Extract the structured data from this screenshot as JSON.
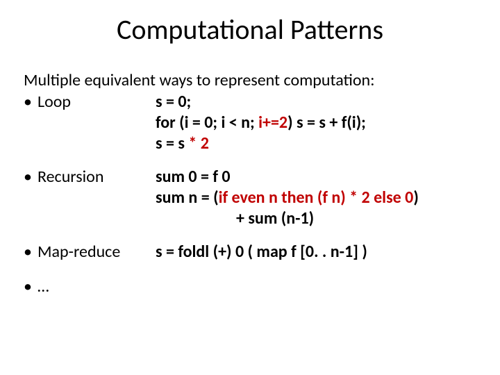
{
  "title": "Computational Patterns",
  "lead": "Multiple equivalent ways to represent computation:",
  "bullets": {
    "loop": "Loop",
    "recursion": "Recursion",
    "mapreduce": "Map-reduce",
    "ellipsis": "…"
  },
  "loop": {
    "l1": "s = 0;",
    "l2a": "for (i = 0; i < n; ",
    "l2b": "i+=2",
    "l2c": ")  s = s + f(i);",
    "l3a": "s = s ",
    "l3b": "* 2"
  },
  "recursion": {
    "l1": "sum 0 = f 0",
    "l2a": "sum n = (",
    "l2b": "if even n then (f n) * 2 else 0",
    "l2c": ")",
    "l3": "+ sum (n-1)"
  },
  "mapreduce": {
    "l1": "s = foldl (+) 0 ( map f [0. . n-1] )"
  },
  "dot": "•"
}
